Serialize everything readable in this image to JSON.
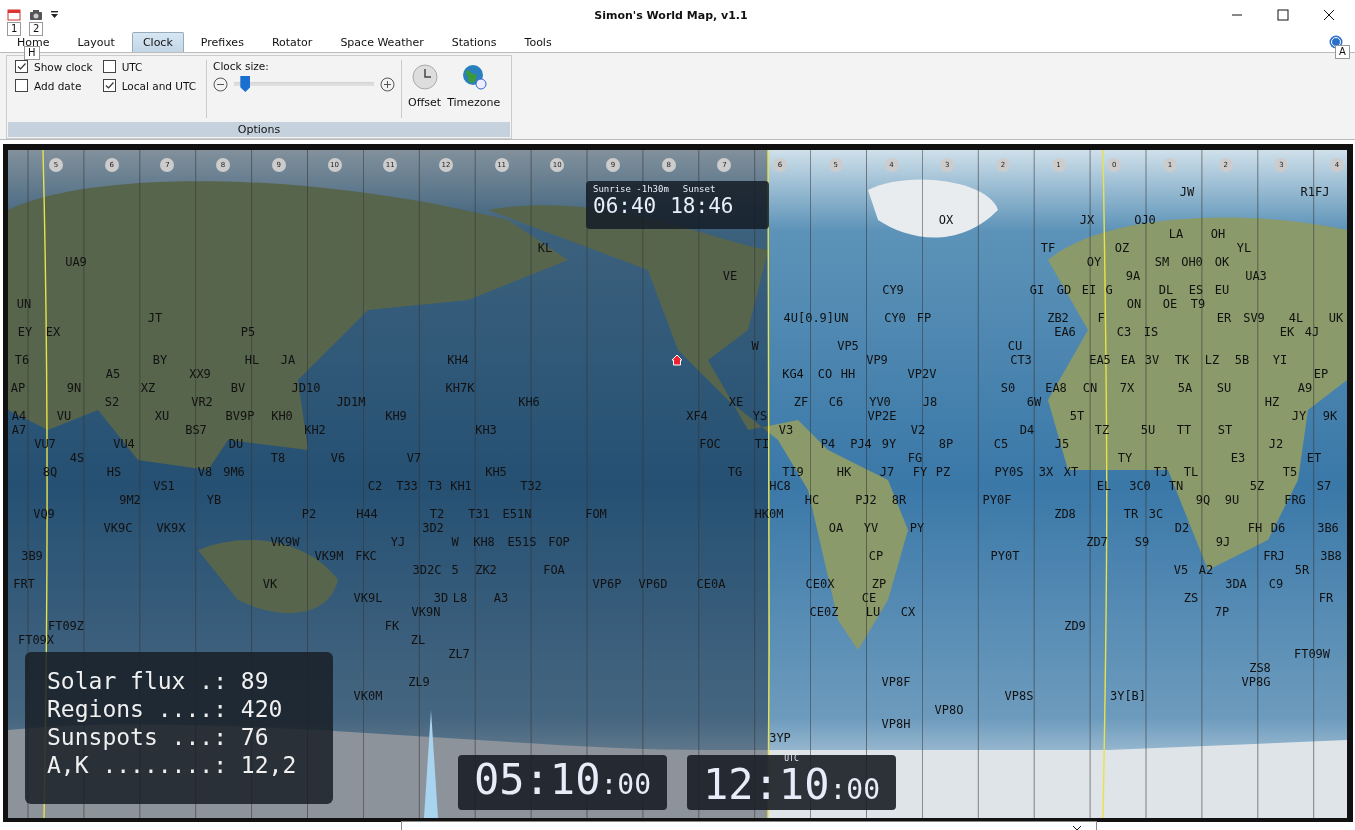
{
  "window": {
    "title": "Simon's World Map, v1.1"
  },
  "quick_access": {
    "key_tips": [
      "1",
      "2"
    ]
  },
  "tabs": [
    {
      "label": "Home",
      "selected": false
    },
    {
      "label": "Layout",
      "selected": false
    },
    {
      "label": "Clock",
      "selected": true
    },
    {
      "label": "Prefixes",
      "selected": false
    },
    {
      "label": "Rotator",
      "selected": false
    },
    {
      "label": "Space Weather",
      "selected": false
    },
    {
      "label": "Stations",
      "selected": false
    },
    {
      "label": "Tools",
      "selected": false
    }
  ],
  "tab_key_tip": "H",
  "help_key_tip": "A",
  "ribbon": {
    "group": "Options",
    "checkboxes": [
      {
        "label": "Show clock",
        "checked": true
      },
      {
        "label": "Add date",
        "checked": false
      },
      {
        "label": "UTC",
        "checked": false
      },
      {
        "label": "Local and UTC",
        "checked": true
      }
    ],
    "clock_size": {
      "label": "Clock size:",
      "level": 0.08
    },
    "buttons": [
      {
        "label": "Offset",
        "kind": "clock"
      },
      {
        "label": "Timezone",
        "kind": "globe"
      }
    ]
  },
  "map": {
    "timezone_hours": [
      "5",
      "6",
      "7",
      "8",
      "9",
      "10",
      "11",
      "12",
      "11",
      "10",
      "9",
      "8",
      "7",
      "6",
      "5",
      "4",
      "3",
      "2",
      "1",
      "0",
      "1",
      "2",
      "3",
      "4"
    ],
    "prefixes": [
      "JW",
      "R1FJ",
      "OX",
      "JX",
      "OJ0",
      "LA",
      "OH",
      "KL",
      "TF",
      "OZ",
      "YL",
      "UA9",
      "OY",
      "SM",
      "OH0",
      "OK",
      "VE",
      "9A",
      "UA3",
      "CY9",
      "GI",
      "GD",
      "EI",
      "G",
      "DL",
      "ES",
      "EU",
      "UN",
      "ON",
      "OE",
      "T9",
      "JT",
      "4U[0.9]UN",
      "CY0",
      "FP",
      "ZB2",
      "F",
      "ER",
      "SV9",
      "4L",
      "UK",
      "EY",
      "EX",
      "P5",
      "EA6",
      "C3",
      "IS",
      "EK",
      "4J",
      "W",
      "VP5",
      "CU",
      "T6",
      "BY",
      "HL",
      "JA",
      "KH4",
      "VP9",
      "CT3",
      "EA5",
      "EA",
      "3V",
      "TK",
      "LZ",
      "5B",
      "YI",
      "A5",
      "XX9",
      "KG4",
      "CO",
      "HH",
      "VP2V",
      "EP",
      "AP",
      "9N",
      "XZ",
      "BV",
      "JD10",
      "KH7K",
      "S0",
      "EA8",
      "CN",
      "7X",
      "5A",
      "SU",
      "A9",
      "S2",
      "VR2",
      "JD1M",
      "KH6",
      "XE",
      "ZF",
      "C6",
      "YV0",
      "J8",
      "6W",
      "HZ",
      "A4",
      "VU",
      "XU",
      "BV9P",
      "KH0",
      "KH9",
      "XF4",
      "YS",
      "VP2E",
      "5T",
      "JY",
      "9K",
      "A7",
      "BS7",
      "KH2",
      "KH3",
      "V3",
      "V2",
      "D4",
      "TZ",
      "5U",
      "TT",
      "ST",
      "VU7",
      "VU4",
      "DU",
      "FOC",
      "TI",
      "P4",
      "PJ4",
      "9Y",
      "8P",
      "C5",
      "J5",
      "J2",
      "4S",
      "T8",
      "V6",
      "V7",
      "FG",
      "TY",
      "E3",
      "ET",
      "8Q",
      "HS",
      "V8",
      "9M6",
      "KH5",
      "TG",
      "TI9",
      "HK",
      "J7",
      "FY",
      "PZ",
      "PY0S",
      "3X",
      "XT",
      "TJ",
      "TL",
      "T5",
      "VS1",
      "C2",
      "T33",
      "T3",
      "KH1",
      "T32",
      "HC8",
      "EL",
      "3C0",
      "TN",
      "5Z",
      "S7",
      "9M2",
      "YB",
      "HC",
      "PJ2",
      "8R",
      "PY0F",
      "9Q",
      "9U",
      "FRG",
      "VQ9",
      "P2",
      "H44",
      "T2",
      "T31",
      "E51N",
      "FOM",
      "HK0M",
      "ZD8",
      "TR",
      "3C",
      "VK9C",
      "VK9X",
      "3D2",
      "OA",
      "YV",
      "PY",
      "D2",
      "FH",
      "D6",
      "3B6",
      "VK9W",
      "YJ",
      "W",
      "KH8",
      "E51S",
      "FOP",
      "ZD7",
      "S9",
      "9J",
      "3B9",
      "VK9M",
      "FKC",
      "CP",
      "PY0T",
      "FRJ",
      "3B8",
      "3D2C",
      "5",
      "ZK2",
      "FOA",
      "V5",
      "A2",
      "5R",
      "FRT",
      "VK",
      "VP6P",
      "VP6D",
      "CE0A",
      "CE0X",
      "ZP",
      "3DA",
      "C9",
      "VK9L",
      "3D",
      "L8",
      "A3",
      "CE",
      "ZS",
      "FR",
      "VK9N",
      "CE0Z",
      "LU",
      "CX",
      "7P",
      "FT09Z",
      "FK",
      "ZD9",
      "FT09X",
      "ZL",
      "ZL7",
      "FT09W",
      "ZS8",
      "ZL9",
      "VP8F",
      "VP8G",
      "VK0M",
      "VP8S",
      "3Y[B]",
      "VP8O",
      "VP8H",
      "3YP"
    ],
    "sun_box": {
      "sunrise_label": "Sunrise -1h30m",
      "sunset_label": "Sunset",
      "sunrise": "06:40",
      "sunset": "18:46"
    },
    "space_weather": [
      {
        "label": "Solar flux .:",
        "value": "89"
      },
      {
        "label": "Regions ....:",
        "value": "420"
      },
      {
        "label": "Sunspots ...:",
        "value": "76"
      },
      {
        "label": "A,K ........:",
        "value": "12,2"
      }
    ],
    "clocks": [
      {
        "time": "05:10",
        "seconds": ":00"
      },
      {
        "time": "12:10",
        "seconds": ":00",
        "caption": "UTC"
      }
    ]
  }
}
